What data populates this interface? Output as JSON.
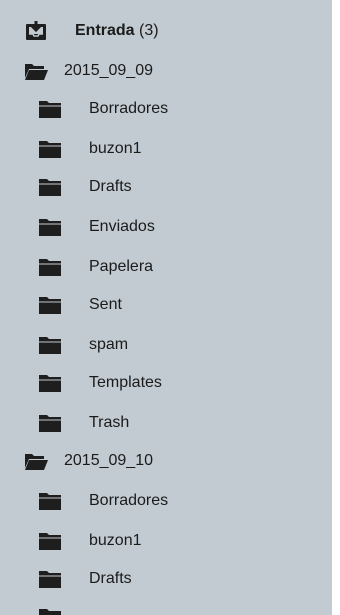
{
  "inbox": {
    "label": "Entrada",
    "count": "(3)",
    "icon": "inbox-download-icon"
  },
  "groups": [
    {
      "label": "2015_09_09",
      "icon": "folder-open-icon",
      "children": [
        "Borradores",
        "buzon1",
        "Drafts",
        "Enviados",
        "Papelera",
        "Sent",
        "spam",
        "Templates",
        "Trash"
      ]
    },
    {
      "label": "2015_09_10",
      "icon": "folder-open-icon",
      "children": [
        "Borradores",
        "buzon1",
        "Drafts"
      ]
    }
  ],
  "colors": {
    "panel_bg": "#c1cbd1",
    "icon": "#1e1e1e",
    "text": "#1b1b1b"
  }
}
